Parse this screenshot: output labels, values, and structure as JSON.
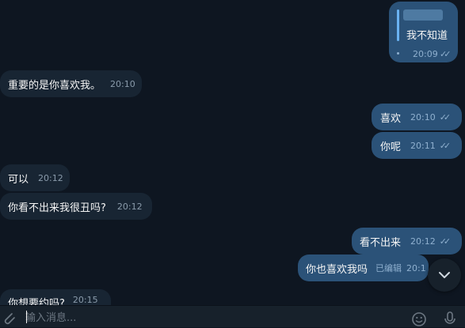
{
  "messages": {
    "m1": {
      "text": "我不知道",
      "time": "20:09",
      "check": "✓✓"
    },
    "m2": {
      "text": "重要的是你喜欢我。",
      "time": "20:10"
    },
    "m3": {
      "text": "喜欢",
      "time": "20:10",
      "check": "✓✓"
    },
    "m4": {
      "text": "你呢",
      "time": "20:11",
      "check": "✓✓"
    },
    "m5": {
      "text": "可以",
      "time": "20:12"
    },
    "m6": {
      "text": "你看不出来我很丑吗?",
      "time": "20:12"
    },
    "m7": {
      "text": "看不出来",
      "time": "20:12",
      "check": "✓✓"
    },
    "m8": {
      "text": "你也喜欢我吗",
      "edited": "已编辑",
      "time": "20:1"
    },
    "m9": {
      "text": "你想要约吗?",
      "time": "20:15"
    }
  },
  "composer": {
    "placeholder": "输入消息..."
  },
  "colors": {
    "background": "#0e1621",
    "incoming": "#182533",
    "outgoing": "#2b5278",
    "accent": "#6ab3f3"
  },
  "icons": {
    "attach": "paperclip-icon",
    "emoji": "emoji-icon",
    "voice": "microphone-icon",
    "scroll": "chevron-down-icon"
  }
}
